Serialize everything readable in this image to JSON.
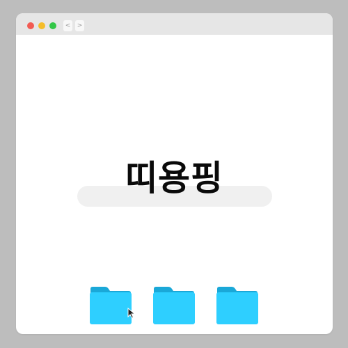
{
  "window": {
    "traffic_lights": {
      "close_color": "#f25b53",
      "minimize_color": "#f5bd2a",
      "zoom_color": "#33c748"
    },
    "nav": {
      "back_label": "<",
      "forward_label": ">"
    }
  },
  "main": {
    "title": "띠용핑"
  },
  "folders": [
    {
      "icon": "folder-icon",
      "color": "#2bcfff"
    },
    {
      "icon": "folder-icon",
      "color": "#2bcfff"
    },
    {
      "icon": "folder-icon",
      "color": "#2bcfff"
    }
  ],
  "cursor": {
    "icon": "mouse-pointer-icon"
  }
}
